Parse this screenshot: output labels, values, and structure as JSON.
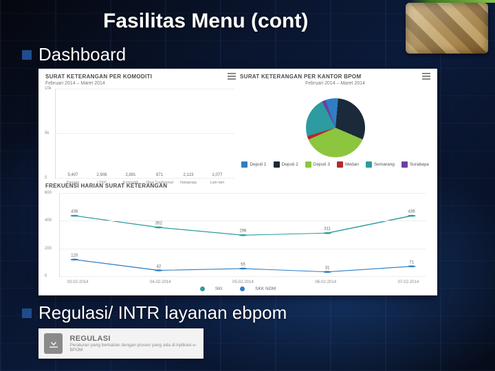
{
  "slide": {
    "title": "Fasilitas Menu (cont)",
    "bullet1": "Dashboard",
    "bullet2": "Regulasi/ INTR layanan ebpom"
  },
  "dashboard": {
    "bar": {
      "title": "SURAT KETERANGAN PER KOMODITI",
      "subtitle": "Februari 2014 – Maret 2014"
    },
    "pie": {
      "title": "SURAT KETERANGAN PER KANTOR BPOM",
      "subtitle": "Februari 2014 – Maret 2014"
    },
    "line": {
      "title": "FREKUENSI HARIAN SURAT KETERANGAN",
      "legend_a": "SKI",
      "legend_b": "SKK NOM"
    }
  },
  "regulasi": {
    "heading": "REGULASI",
    "desc": "Peraturan yang berkaitan dengan proses yang ada di Aplikasi e-BPOM"
  },
  "chart_data": [
    {
      "type": "bar",
      "title": "SURAT KETERANGAN PER KOMODITI",
      "subtitle": "Februari 2014 – Maret 2014",
      "categories": [
        "Pangan",
        "LTKP",
        "Kosmetik",
        "Obat Tradisional",
        "Natapraja",
        "Lain-lain"
      ],
      "values": [
        5407,
        2908,
        2891,
        871,
        2123,
        2077
      ],
      "ylim": [
        0,
        10000
      ],
      "yticks": [
        0,
        5000,
        10000
      ]
    },
    {
      "type": "pie",
      "title": "SURAT KETERANGAN PER KANTOR BPOM",
      "subtitle": "Februari 2014 – Maret 2014",
      "series": [
        {
          "name": "Deputi 1",
          "value": 7,
          "color": "#2f7ec4"
        },
        {
          "name": "Deputi 2",
          "value": 30,
          "color": "#1a2a3a"
        },
        {
          "name": "Deputi 3",
          "value": 37,
          "color": "#8cc63f"
        },
        {
          "name": "Medan",
          "value": 2,
          "color": "#b22a2a"
        },
        {
          "name": "Semarang",
          "value": 22,
          "color": "#2d9ba0"
        },
        {
          "name": "Surabaya",
          "value": 2,
          "color": "#6b3fa0"
        }
      ]
    },
    {
      "type": "line",
      "title": "FREKUENSI HARIAN SURAT KETERANGAN",
      "x": [
        "03-02-2014",
        "04-02-2014",
        "05-02-2014",
        "06-02-2014",
        "07-02-2014"
      ],
      "series": [
        {
          "name": "SKI",
          "color": "#2d9ba0",
          "values": [
            436,
            352,
            296,
            311,
            436
          ]
        },
        {
          "name": "SKK NOM",
          "color": "#2f7ec4",
          "values": [
            120,
            42,
            55,
            31,
            71
          ]
        }
      ],
      "ylim": [
        0,
        600
      ],
      "yticks": [
        0,
        200,
        400,
        600
      ]
    }
  ]
}
